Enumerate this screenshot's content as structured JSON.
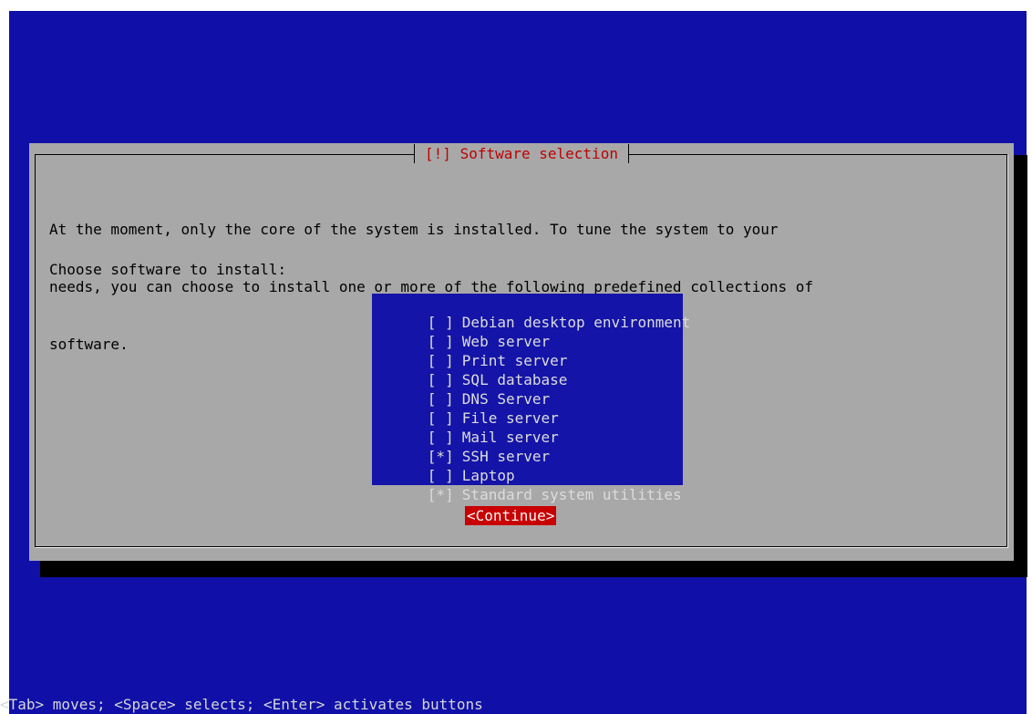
{
  "dialog": {
    "title": "[!] Software selection",
    "intro_lines": [
      "At the moment, only the core of the system is installed. To tune the system to your",
      "needs, you can choose to install one or more of the following predefined collections of",
      "software."
    ],
    "prompt": "Choose software to install:",
    "options": [
      {
        "mark": "[ ]",
        "label": "Debian desktop environment",
        "selected": false
      },
      {
        "mark": "[ ]",
        "label": "Web server",
        "selected": false
      },
      {
        "mark": "[ ]",
        "label": "Print server",
        "selected": false
      },
      {
        "mark": "[ ]",
        "label": "SQL database",
        "selected": false
      },
      {
        "mark": "[ ]",
        "label": "DNS Server",
        "selected": false
      },
      {
        "mark": "[ ]",
        "label": "File server",
        "selected": false
      },
      {
        "mark": "[ ]",
        "label": "Mail server",
        "selected": false
      },
      {
        "mark": "[*]",
        "label": "SSH server",
        "selected": true
      },
      {
        "mark": "[ ]",
        "label": "Laptop",
        "selected": false
      },
      {
        "mark": "[*]",
        "label": "Standard system utilities",
        "selected": true
      }
    ],
    "continue_label": "<Continue>"
  },
  "footer": {
    "help": "<Tab> moves; <Space> selects; <Enter> activates buttons"
  },
  "colors": {
    "background": "#1010a8",
    "dialog": "#a8a8a8",
    "title": "#c00000",
    "list_background": "#1414a8",
    "button_background": "#c80000"
  }
}
